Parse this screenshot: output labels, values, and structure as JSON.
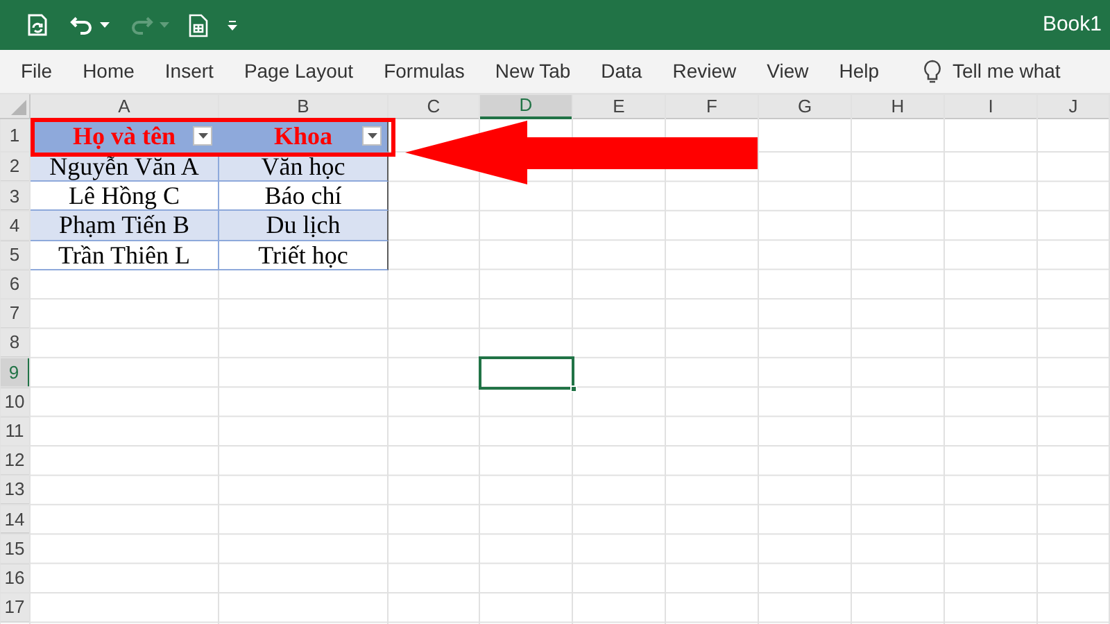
{
  "title_bar": {
    "document_title": "Book1"
  },
  "ribbon_tabs": [
    {
      "label": "File"
    },
    {
      "label": "Home"
    },
    {
      "label": "Insert"
    },
    {
      "label": "Page Layout"
    },
    {
      "label": "Formulas"
    },
    {
      "label": "New Tab"
    },
    {
      "label": "Data"
    },
    {
      "label": "Review"
    },
    {
      "label": "View"
    },
    {
      "label": "Help"
    }
  ],
  "tell_me": {
    "placeholder": "Tell me what"
  },
  "column_headers": [
    {
      "label": "A",
      "selected": false
    },
    {
      "label": "B",
      "selected": false
    },
    {
      "label": "C",
      "selected": false
    },
    {
      "label": "D",
      "selected": true
    },
    {
      "label": "E",
      "selected": false
    },
    {
      "label": "F",
      "selected": false
    },
    {
      "label": "G",
      "selected": false
    },
    {
      "label": "H",
      "selected": false
    },
    {
      "label": "I",
      "selected": false
    },
    {
      "label": "J",
      "selected": false
    }
  ],
  "row_headers": [
    {
      "label": "1",
      "selected": false
    },
    {
      "label": "2",
      "selected": false
    },
    {
      "label": "3",
      "selected": false
    },
    {
      "label": "4",
      "selected": false
    },
    {
      "label": "5",
      "selected": false
    },
    {
      "label": "6",
      "selected": false
    },
    {
      "label": "7",
      "selected": false
    },
    {
      "label": "8",
      "selected": false
    },
    {
      "label": "9",
      "selected": true
    },
    {
      "label": "10",
      "selected": false
    },
    {
      "label": "11",
      "selected": false
    },
    {
      "label": "12",
      "selected": false
    },
    {
      "label": "13",
      "selected": false
    },
    {
      "label": "14",
      "selected": false
    },
    {
      "label": "15",
      "selected": false
    },
    {
      "label": "16",
      "selected": false
    },
    {
      "label": "17",
      "selected": false
    }
  ],
  "table": {
    "columns": [
      "Họ và tên",
      "Khoa"
    ],
    "rows": [
      [
        "Nguyễn Văn A",
        "Văn học"
      ],
      [
        "Lê Hồng C",
        "Báo chí"
      ],
      [
        "Phạm Tiến B",
        "Du lịch"
      ],
      [
        "Trần Thiên L",
        "Triết học"
      ]
    ]
  }
}
